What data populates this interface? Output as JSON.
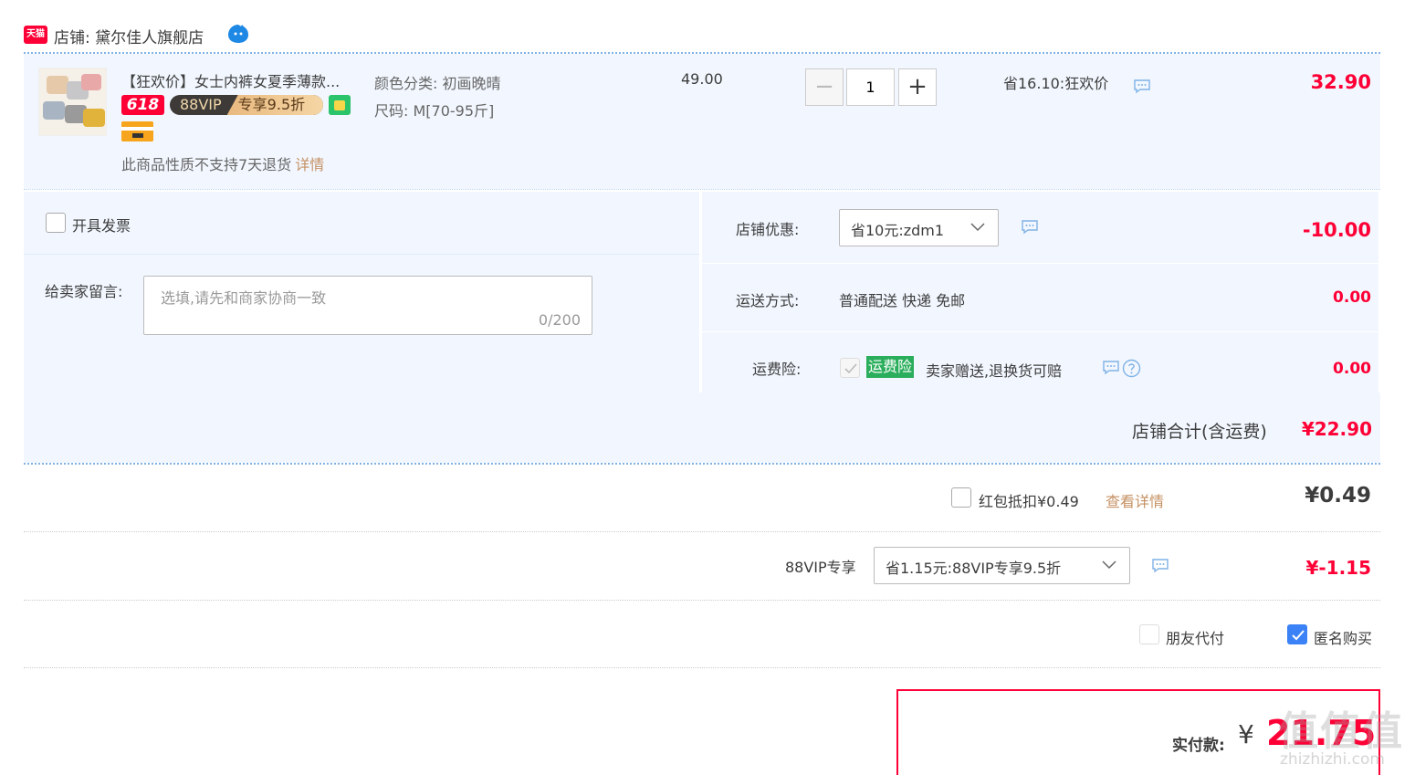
{
  "colors": {
    "accent_red": "#ff0036",
    "link_gold": "#c59163",
    "row_bg": "#f2f7ff",
    "ins_green": "#2bae5c",
    "check_blue": "#3b82f6"
  },
  "store": {
    "label": "店铺: 黛尔佳人旗舰店",
    "badge_text": "天猫"
  },
  "product": {
    "title": "【狂欢价】女士内裤女夏季薄款...",
    "badge_618": "618",
    "vip_badge": "88VIP",
    "vip_discount": "专享9.5折",
    "sku_color": "颜色分类: 初画晚晴",
    "sku_size": "尺码: M[70-95斤]",
    "no_return": "此商品性质不支持7天退货",
    "detail_link": "详情",
    "unit_price": "49.00",
    "quantity": "1",
    "minus": "−",
    "plus": "+",
    "saving": "省16.10:狂欢价",
    "line_total": "32.90"
  },
  "options": {
    "invoice_label": "开具发票",
    "message_label": "给卖家留言:",
    "message_placeholder": "选填,请先和商家协商一致",
    "message_count": "0/200",
    "shop_coupon_label": "店铺优惠:",
    "shop_coupon_value": "省10元:zdm1",
    "shop_coupon_amount": "-10.00",
    "shipping_label": "运送方式:",
    "shipping_value": "普通配送 快递 免邮",
    "shipping_amount": "0.00",
    "insurance_label": "运费险:",
    "insurance_tag": "运费险",
    "insurance_text": "卖家赠送,退换货可赔",
    "insurance_amount": "0.00",
    "subtotal_label": "店铺合计(含运费)",
    "subtotal_value": "¥22.90"
  },
  "redpack": {
    "label": "红包抵扣¥0.49",
    "link": "查看详情",
    "value": "¥0.49"
  },
  "vip": {
    "label": "88VIP专享",
    "select_value": "省1.15元:88VIP专享9.5折",
    "amount": "¥-1.15"
  },
  "pay_options": {
    "friend_pay": "朋友代付",
    "anonymous": "匿名购买"
  },
  "payment": {
    "label": "实付款:",
    "currency": "¥",
    "amount": "21.75"
  },
  "watermark": {
    "main": "值值值",
    "sub": "zhizhizhi.com"
  }
}
